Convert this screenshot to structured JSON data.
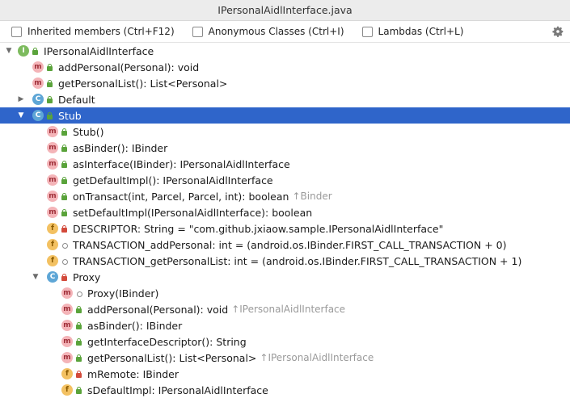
{
  "window": {
    "title": "IPersonalAidlInterface.java"
  },
  "options": [
    {
      "label": "Inherited members (Ctrl+F12)"
    },
    {
      "label": "Anonymous Classes (Ctrl+I)"
    },
    {
      "label": "Lambdas (Ctrl+L)"
    }
  ],
  "gear_icon": "gear-icon",
  "tree": [
    {
      "text": "IPersonalAidlInterface",
      "kind": "I",
      "vis": "pub",
      "arrow": "expanded"
    },
    {
      "text": "addPersonal(Personal): void",
      "kind": "m",
      "vis": "pub",
      "abstract": true
    },
    {
      "text": "getPersonalList(): List<Personal>",
      "kind": "m",
      "vis": "pub",
      "abstract": true
    },
    {
      "text": "Default",
      "kind": "C",
      "vis": "pub",
      "arrow": "collapsed"
    },
    {
      "text": "Stub",
      "kind": "C",
      "vis": "pub",
      "arrow": "expanded",
      "selected": true
    },
    {
      "text": "Stub()",
      "kind": "m",
      "vis": "pub"
    },
    {
      "text": "asBinder(): IBinder",
      "kind": "m",
      "vis": "pub"
    },
    {
      "text": "asInterface(IBinder): IPersonalAidlInterface",
      "kind": "m",
      "vis": "pub"
    },
    {
      "text": "getDefaultImpl(): IPersonalAidlInterface",
      "kind": "m",
      "vis": "pub"
    },
    {
      "text": "onTransact(int, Parcel, Parcel, int): boolean",
      "hint": "↑Binder",
      "kind": "m",
      "vis": "pub"
    },
    {
      "text": "setDefaultImpl(IPersonalAidlInterface): boolean",
      "kind": "m",
      "vis": "pub"
    },
    {
      "text": "DESCRIPTOR: String = \"com.github.jxiaow.sample.IPersonalAidlInterface\"",
      "kind": "f",
      "vis": "priv"
    },
    {
      "text": "TRANSACTION_addPersonal: int = (android.os.IBinder.FIRST_CALL_TRANSACTION + 0)",
      "kind": "f",
      "vis": "pkg"
    },
    {
      "text": "TRANSACTION_getPersonalList: int = (android.os.IBinder.FIRST_CALL_TRANSACTION + 1)",
      "kind": "f",
      "vis": "pkg"
    },
    {
      "text": "Proxy",
      "kind": "C",
      "vis": "priv",
      "arrow": "expanded"
    },
    {
      "text": "Proxy(IBinder)",
      "kind": "m",
      "vis": "pkg"
    },
    {
      "text": "addPersonal(Personal): void",
      "hint": "↑IPersonalAidlInterface",
      "kind": "m",
      "vis": "pub"
    },
    {
      "text": "asBinder(): IBinder",
      "kind": "m",
      "vis": "pub"
    },
    {
      "text": "getInterfaceDescriptor(): String",
      "kind": "m",
      "vis": "pub"
    },
    {
      "text": "getPersonalList(): List<Personal>",
      "hint": "↑IPersonalAidlInterface",
      "kind": "m",
      "vis": "pub"
    },
    {
      "text": "mRemote: IBinder",
      "kind": "f",
      "vis": "priv"
    },
    {
      "text": "sDefaultImpl: IPersonalAidlInterface",
      "kind": "f",
      "vis": "pub"
    }
  ]
}
